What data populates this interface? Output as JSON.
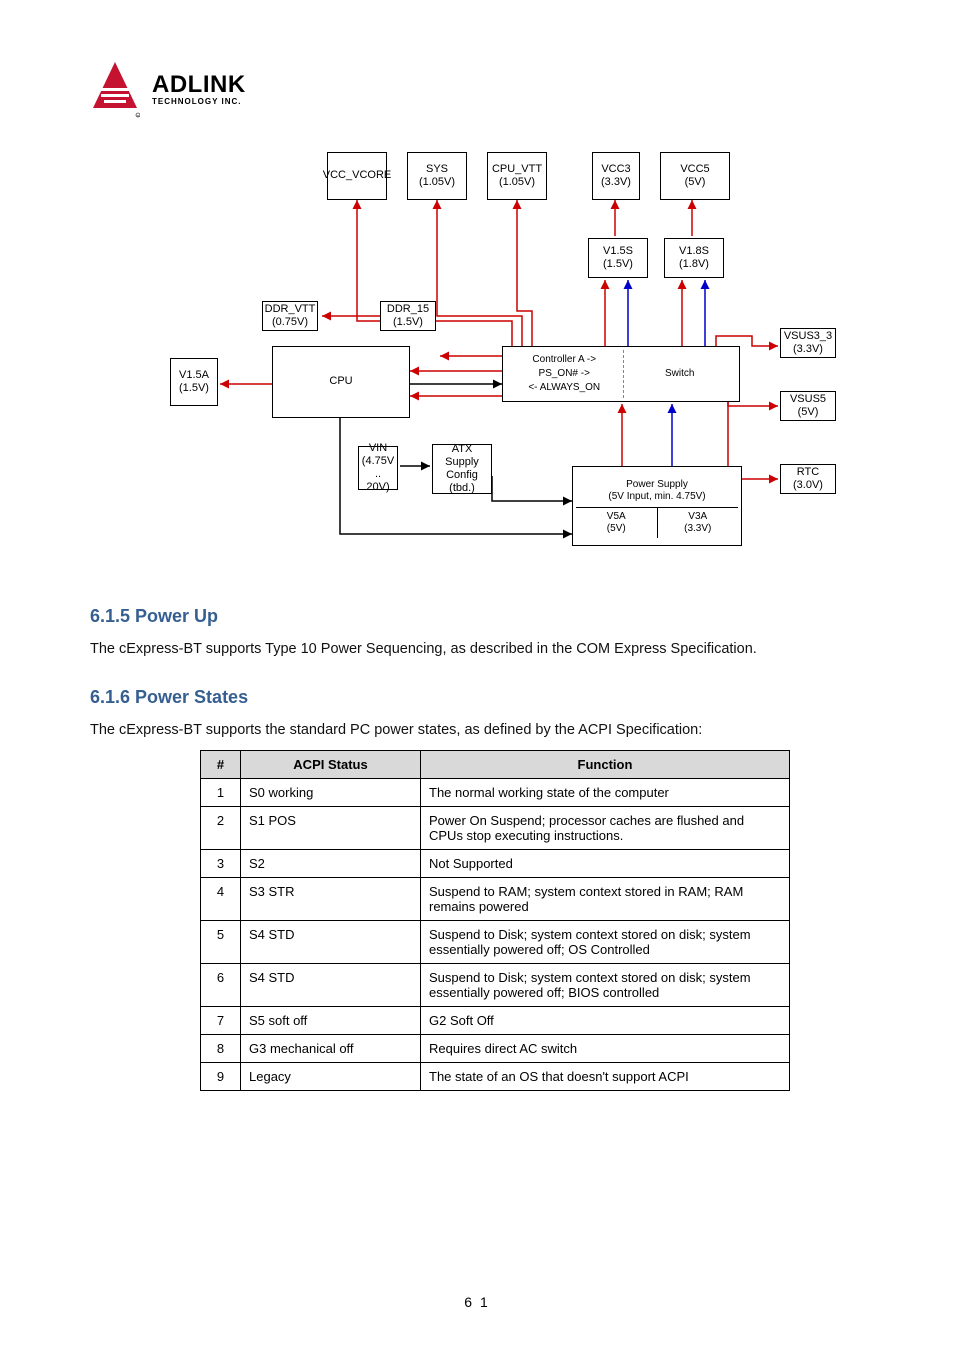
{
  "logo": {
    "name": "ADLINK",
    "sub": "TECHNOLOGY INC."
  },
  "diagram": {
    "top_row": [
      {
        "l1": "VCC_VCORE"
      },
      {
        "l1": "SYS",
        "l2": "(1.05V)"
      },
      {
        "l1": "CPU_VTT",
        "l2": "(1.05V)"
      },
      {
        "l1": "VCC3",
        "l2": "(3.3V)"
      },
      {
        "l1": "VCC5",
        "l2": "(5V)"
      }
    ],
    "mid_row": [
      {
        "l1": "V1.5S",
        "l2": "(1.5V)"
      },
      {
        "l1": "V1.8S",
        "l2": "(1.8V)"
      }
    ],
    "ddr": {
      "l1": "DDR_15",
      "l2": "(1.5V)"
    },
    "ddr_v": {
      "l1": "DDR_VTT",
      "l2": "(0.75V)"
    },
    "soc": {
      "l1": "V1.5A",
      "l2": "(1.5V)"
    },
    "vsus33": {
      "l1": "VSUS3_3",
      "l2": "(3.3V)"
    },
    "vsus5": {
      "l1": "VSUS5",
      "l2": "(5V)"
    },
    "ctrl1": {
      "l1": "Controller A ->",
      "l2": "PS_ON# ->",
      "l3": "<- ALWAYS_ON"
    },
    "ctrl2": {
      "l1": "ATX",
      "l2": "Supply",
      "l3": "Config",
      "l4": "(tbd.)"
    },
    "cpu": "CPU",
    "switch": "Switch",
    "vin": {
      "l1": "VIN",
      "l2": "(4.75V ..",
      "l3": "20V)"
    },
    "psu": {
      "l1": "Power Supply",
      "l2": "(5V Input, min. 4.75V)"
    },
    "v5a": {
      "l1": "V5A",
      "l2": "(5V)"
    },
    "v3a": {
      "l1": "V3A",
      "l2": "(3.3V)"
    },
    "rtc": {
      "l1": "RTC",
      "l2": "(3.0V)"
    }
  },
  "sections": {
    "seq_h": "6.1.5 Power Up",
    "seq_p": "The cExpress-BT supports Type 10 Power Sequencing, as described in the COM Express Specification.",
    "state_h": "6.1.6 Power States",
    "state_p": "The cExpress-BT supports the standard PC power states, as defined by the ACPI Specification:",
    "table_h": [
      "#",
      "ACPI Status",
      "Function"
    ],
    "table": [
      [
        "1",
        "S0 working",
        "The normal working state of the computer"
      ],
      [
        "2",
        "S1 POS",
        "Power On Suspend; processor caches are flushed and CPUs stop executing instructions."
      ],
      [
        "3",
        "S2",
        "Not Supported"
      ],
      [
        "4",
        "S3 STR",
        "Suspend to RAM; system context stored in RAM; RAM remains powered"
      ],
      [
        "5",
        "S4 STD",
        "Suspend to Disk; system context stored on disk; system essentially powered off; OS Controlled"
      ],
      [
        "6",
        "S4 STD",
        "Suspend to Disk; system context stored on disk; system essentially powered off; BIOS controlled"
      ],
      [
        "7",
        "S5 soft off",
        "G2 Soft Off"
      ],
      [
        "8",
        "G3 mechanical off",
        "Requires direct AC switch"
      ],
      [
        "9",
        "Legacy",
        "The state of an OS that doesn't support ACPI"
      ]
    ]
  },
  "page_num": "6 1"
}
